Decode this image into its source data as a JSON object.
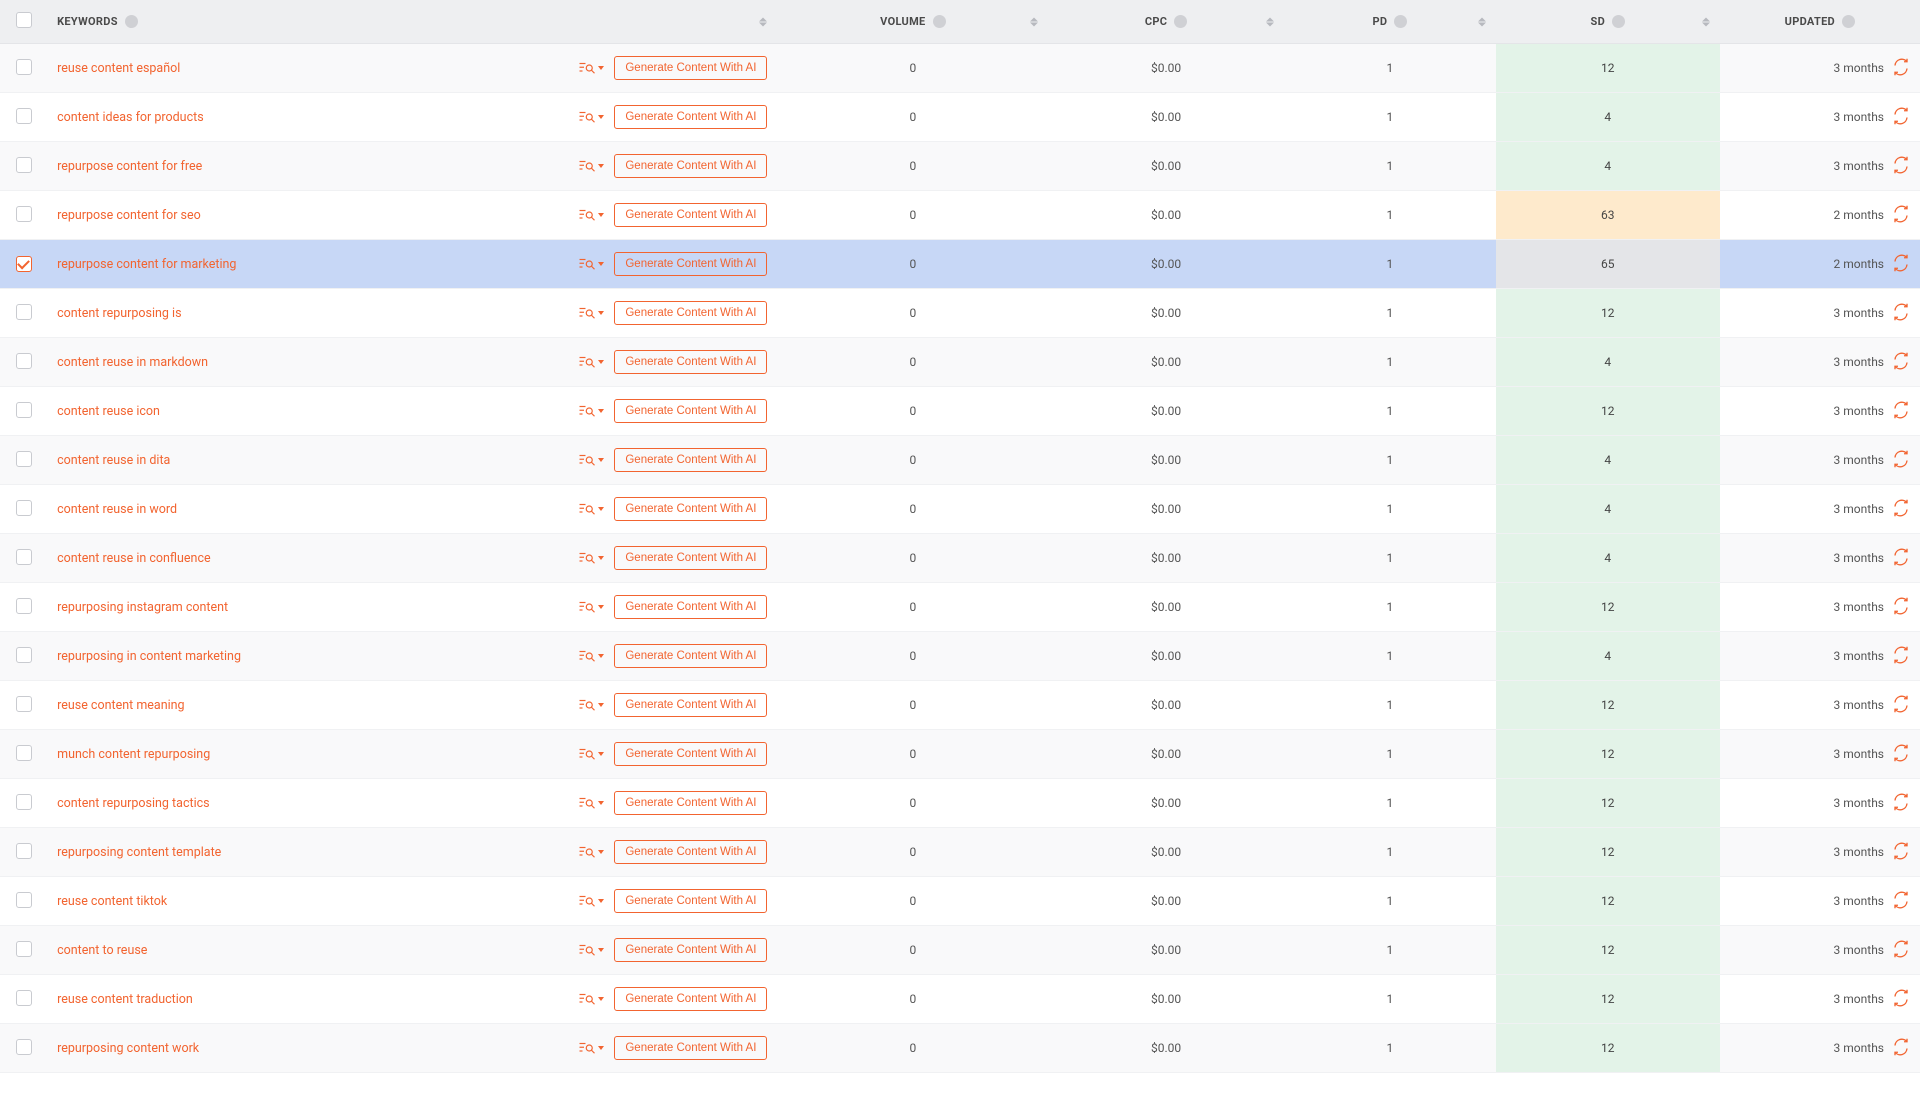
{
  "columns": {
    "keywords": "KEYWORDS",
    "volume": "VOLUME",
    "cpc": "CPC",
    "pd": "PD",
    "sd": "SD",
    "updated": "UPDATED"
  },
  "buttons": {
    "generate": "Generate Content With AI"
  },
  "rows": [
    {
      "checked": false,
      "keyword": "reuse content español",
      "volume": "0",
      "cpc": "$0.00",
      "pd": "1",
      "sd": "12",
      "sd_band": "low",
      "updated": "3 months"
    },
    {
      "checked": false,
      "keyword": "content ideas for products",
      "volume": "0",
      "cpc": "$0.00",
      "pd": "1",
      "sd": "4",
      "sd_band": "low",
      "updated": "3 months"
    },
    {
      "checked": false,
      "keyword": "repurpose content for free",
      "volume": "0",
      "cpc": "$0.00",
      "pd": "1",
      "sd": "4",
      "sd_band": "low",
      "updated": "3 months"
    },
    {
      "checked": false,
      "keyword": "repurpose content for seo",
      "volume": "0",
      "cpc": "$0.00",
      "pd": "1",
      "sd": "63",
      "sd_band": "mid",
      "updated": "2 months"
    },
    {
      "checked": true,
      "keyword": "repurpose content for marketing",
      "volume": "0",
      "cpc": "$0.00",
      "pd": "1",
      "sd": "65",
      "sd_band": "high",
      "updated": "2 months"
    },
    {
      "checked": false,
      "keyword": "content repurposing is",
      "volume": "0",
      "cpc": "$0.00",
      "pd": "1",
      "sd": "12",
      "sd_band": "low",
      "updated": "3 months"
    },
    {
      "checked": false,
      "keyword": "content reuse in markdown",
      "volume": "0",
      "cpc": "$0.00",
      "pd": "1",
      "sd": "4",
      "sd_band": "low",
      "updated": "3 months"
    },
    {
      "checked": false,
      "keyword": "content reuse icon",
      "volume": "0",
      "cpc": "$0.00",
      "pd": "1",
      "sd": "12",
      "sd_band": "low",
      "updated": "3 months"
    },
    {
      "checked": false,
      "keyword": "content reuse in dita",
      "volume": "0",
      "cpc": "$0.00",
      "pd": "1",
      "sd": "4",
      "sd_band": "low",
      "updated": "3 months"
    },
    {
      "checked": false,
      "keyword": "content reuse in word",
      "volume": "0",
      "cpc": "$0.00",
      "pd": "1",
      "sd": "4",
      "sd_band": "low",
      "updated": "3 months"
    },
    {
      "checked": false,
      "keyword": "content reuse in confluence",
      "volume": "0",
      "cpc": "$0.00",
      "pd": "1",
      "sd": "4",
      "sd_band": "low",
      "updated": "3 months"
    },
    {
      "checked": false,
      "keyword": "repurposing instagram content",
      "volume": "0",
      "cpc": "$0.00",
      "pd": "1",
      "sd": "12",
      "sd_band": "low",
      "updated": "3 months"
    },
    {
      "checked": false,
      "keyword": "repurposing in content marketing",
      "volume": "0",
      "cpc": "$0.00",
      "pd": "1",
      "sd": "4",
      "sd_band": "low",
      "updated": "3 months"
    },
    {
      "checked": false,
      "keyword": "reuse content meaning",
      "volume": "0",
      "cpc": "$0.00",
      "pd": "1",
      "sd": "12",
      "sd_band": "low",
      "updated": "3 months"
    },
    {
      "checked": false,
      "keyword": "munch content repurposing",
      "volume": "0",
      "cpc": "$0.00",
      "pd": "1",
      "sd": "12",
      "sd_band": "low",
      "updated": "3 months"
    },
    {
      "checked": false,
      "keyword": "content repurposing tactics",
      "volume": "0",
      "cpc": "$0.00",
      "pd": "1",
      "sd": "12",
      "sd_band": "low",
      "updated": "3 months"
    },
    {
      "checked": false,
      "keyword": "repurposing content template",
      "volume": "0",
      "cpc": "$0.00",
      "pd": "1",
      "sd": "12",
      "sd_band": "low",
      "updated": "3 months"
    },
    {
      "checked": false,
      "keyword": "reuse content tiktok",
      "volume": "0",
      "cpc": "$0.00",
      "pd": "1",
      "sd": "12",
      "sd_band": "low",
      "updated": "3 months"
    },
    {
      "checked": false,
      "keyword": "content to reuse",
      "volume": "0",
      "cpc": "$0.00",
      "pd": "1",
      "sd": "12",
      "sd_band": "low",
      "updated": "3 months"
    },
    {
      "checked": false,
      "keyword": "reuse content traduction",
      "volume": "0",
      "cpc": "$0.00",
      "pd": "1",
      "sd": "12",
      "sd_band": "low",
      "updated": "3 months"
    },
    {
      "checked": false,
      "keyword": "repurposing content work",
      "volume": "0",
      "cpc": "$0.00",
      "pd": "1",
      "sd": "12",
      "sd_band": "low",
      "updated": "3 months"
    }
  ]
}
